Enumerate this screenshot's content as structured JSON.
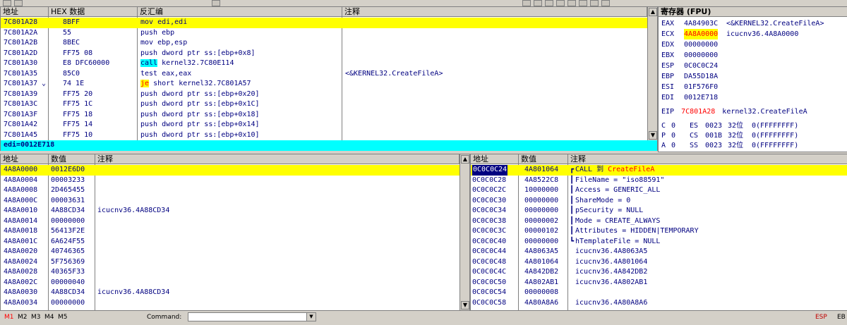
{
  "disasm": {
    "headers": {
      "addr": "地址",
      "hex": "HEX 数据",
      "asm": "反汇编",
      "comment": "注释"
    },
    "rows": [
      {
        "addr": "7C801A28",
        "hex": "8BFF",
        "asm_pre": "",
        "kw": "",
        "asm": "mov edi,edi",
        "comment": "",
        "selected": true
      },
      {
        "addr": "7C801A2A",
        "hex": "55",
        "asm_pre": "",
        "kw": "",
        "asm": "push ebp",
        "comment": ""
      },
      {
        "addr": "7C801A2B",
        "hex": "8BEC",
        "asm_pre": "",
        "kw": "",
        "asm": "mov ebp,esp",
        "comment": ""
      },
      {
        "addr": "7C801A2D",
        "hex": "FF75 08",
        "asm_pre": "",
        "kw": "",
        "asm": "push dword ptr ss:[ebp+0x8]",
        "comment": ""
      },
      {
        "addr": "7C801A30",
        "hex": "E8 DFC60000",
        "asm_pre": "",
        "kw": "call",
        "asm": " kernel32.7C80E114",
        "comment": ""
      },
      {
        "addr": "7C801A35",
        "hex": "85C0",
        "asm_pre": "",
        "kw": "",
        "asm": "test eax,eax",
        "comment": "<&KERNEL32.CreateFileA>"
      },
      {
        "addr": "7C801A37",
        "hex": "74 1E",
        "jmark": "⌄",
        "asm_pre": "",
        "kw": "je",
        "asm": " short kernel32.7C801A57",
        "comment": ""
      },
      {
        "addr": "7C801A39",
        "hex": "FF75 20",
        "asm_pre": "",
        "kw": "",
        "asm": "push dword ptr ss:[ebp+0x20]",
        "comment": ""
      },
      {
        "addr": "7C801A3C",
        "hex": "FF75 1C",
        "asm_pre": "",
        "kw": "",
        "asm": "push dword ptr ss:[ebp+0x1C]",
        "comment": ""
      },
      {
        "addr": "7C801A3F",
        "hex": "FF75 18",
        "asm_pre": "",
        "kw": "",
        "asm": "push dword ptr ss:[ebp+0x18]",
        "comment": ""
      },
      {
        "addr": "7C801A42",
        "hex": "FF75 14",
        "asm_pre": "",
        "kw": "",
        "asm": "push dword ptr ss:[ebp+0x14]",
        "comment": ""
      },
      {
        "addr": "7C801A45",
        "hex": "FF75 10",
        "asm_pre": "",
        "kw": "",
        "asm": "push dword ptr ss:[ebp+0x10]",
        "comment": ""
      }
    ],
    "info_line": "edi=0012E718"
  },
  "registers": {
    "title": "寄存器 (FPU)",
    "regs": [
      {
        "name": "EAX",
        "value": "4A84903C",
        "note": "<&KERNEL32.CreateFileA>"
      },
      {
        "name": "ECX",
        "value": "4A8A0000",
        "note": "icucnv36.4A8A0000",
        "highlight": true
      },
      {
        "name": "EDX",
        "value": "00000000",
        "note": ""
      },
      {
        "name": "EBX",
        "value": "00000000",
        "note": ""
      },
      {
        "name": "ESP",
        "value": "0C0C0C24",
        "note": ""
      },
      {
        "name": "EBP",
        "value": "DA55D18A",
        "note": ""
      },
      {
        "name": "ESI",
        "value": "01F576F0",
        "note": ""
      },
      {
        "name": "EDI",
        "value": "0012E718",
        "note": ""
      }
    ],
    "eip": {
      "name": "EIP",
      "value": "7C801A28",
      "note": "kernel32.CreateFileA"
    },
    "flags": [
      {
        "flag": "C",
        "bit": "0",
        "seg": "ES",
        "sel": "0023",
        "width": "32位",
        "base": "0(FFFFFFFF)"
      },
      {
        "flag": "P",
        "bit": "0",
        "seg": "CS",
        "sel": "001B",
        "width": "32位",
        "base": "0(FFFFFFFF)"
      },
      {
        "flag": "A",
        "bit": "0",
        "seg": "SS",
        "sel": "0023",
        "width": "32位",
        "base": "0(FFFFFFFF)"
      }
    ]
  },
  "dump": {
    "headers": {
      "addr": "地址",
      "value": "数值",
      "comment": "注释"
    },
    "rows": [
      {
        "addr": "4A8A0000",
        "value": "0012E6D0",
        "comment": "",
        "selected": true
      },
      {
        "addr": "4A8A0004",
        "value": "00003233",
        "comment": ""
      },
      {
        "addr": "4A8A0008",
        "value": "2D465455",
        "comment": ""
      },
      {
        "addr": "4A8A000C",
        "value": "00003631",
        "comment": ""
      },
      {
        "addr": "4A8A0010",
        "value": "4A88CD34",
        "comment": "icucnv36.4A88CD34"
      },
      {
        "addr": "4A8A0014",
        "value": "00000000",
        "comment": ""
      },
      {
        "addr": "4A8A0018",
        "value": "56413F2E",
        "comment": ""
      },
      {
        "addr": "4A8A001C",
        "value": "6A624F55",
        "comment": ""
      },
      {
        "addr": "4A8A0020",
        "value": "40746365",
        "comment": ""
      },
      {
        "addr": "4A8A0024",
        "value": "5F756369",
        "comment": ""
      },
      {
        "addr": "4A8A0028",
        "value": "40365F33",
        "comment": ""
      },
      {
        "addr": "4A8A002C",
        "value": "00000040",
        "comment": ""
      },
      {
        "addr": "4A8A0030",
        "value": "4A88CD34",
        "comment": "icucnv36.4A88CD34"
      },
      {
        "addr": "4A8A0034",
        "value": "00000000",
        "comment": ""
      }
    ]
  },
  "stack": {
    "headers": {
      "addr": "地址",
      "value": "数值",
      "comment": "注释"
    },
    "rows": [
      {
        "addr": "0C0C0C24",
        "value": "4A801064",
        "bracket": "┏",
        "comment": "CALL 到 ",
        "comment_red": "CreateFileA",
        "selected": true
      },
      {
        "addr": "0C0C0C28",
        "value": "4A8522C8",
        "bracket": "┃",
        "comment": "FileName = \"iso88591\""
      },
      {
        "addr": "0C0C0C2C",
        "value": "10000000",
        "bracket": "┃",
        "comment": "Access = GENERIC_ALL"
      },
      {
        "addr": "0C0C0C30",
        "value": "00000000",
        "bracket": "┃",
        "comment": "ShareMode = 0"
      },
      {
        "addr": "0C0C0C34",
        "value": "00000000",
        "bracket": "┃",
        "comment": "pSecurity = NULL"
      },
      {
        "addr": "0C0C0C38",
        "value": "00000002",
        "bracket": "┃",
        "comment": "Mode = CREATE_ALWAYS"
      },
      {
        "addr": "0C0C0C3C",
        "value": "00000102",
        "bracket": "┃",
        "comment": "Attributes = HIDDEN|TEMPORARY"
      },
      {
        "addr": "0C0C0C40",
        "value": "00000000",
        "bracket": "┗",
        "comment": "hTemplateFile = NULL"
      },
      {
        "addr": "0C0C0C44",
        "value": "4A8063A5",
        "bracket": "",
        "comment": "icucnv36.4A8063A5"
      },
      {
        "addr": "0C0C0C48",
        "value": "4A801064",
        "bracket": "",
        "comment": "icucnv36.4A801064"
      },
      {
        "addr": "0C0C0C4C",
        "value": "4A842DB2",
        "bracket": "",
        "comment": "icucnv36.4A842DB2"
      },
      {
        "addr": "0C0C0C50",
        "value": "4A802AB1",
        "bracket": "",
        "comment": "icucnv36.4A802AB1"
      },
      {
        "addr": "0C0C0C54",
        "value": "00000008",
        "bracket": "",
        "comment": ""
      },
      {
        "addr": "0C0C0C58",
        "value": "4A80A8A6",
        "bracket": "",
        "comment": "icucnv36.4A80A8A6"
      }
    ]
  },
  "statusbar": {
    "tabs": [
      "M1",
      "M2",
      "M3",
      "M4",
      "M5"
    ],
    "command_label": "Command:",
    "command_value": "",
    "esp_label": "ESP",
    "ebp_label": "EB"
  },
  "icons": {
    "scroll_up": "up-arrow",
    "scroll_down": "down-arrow",
    "dropdown": "chevron-down"
  }
}
